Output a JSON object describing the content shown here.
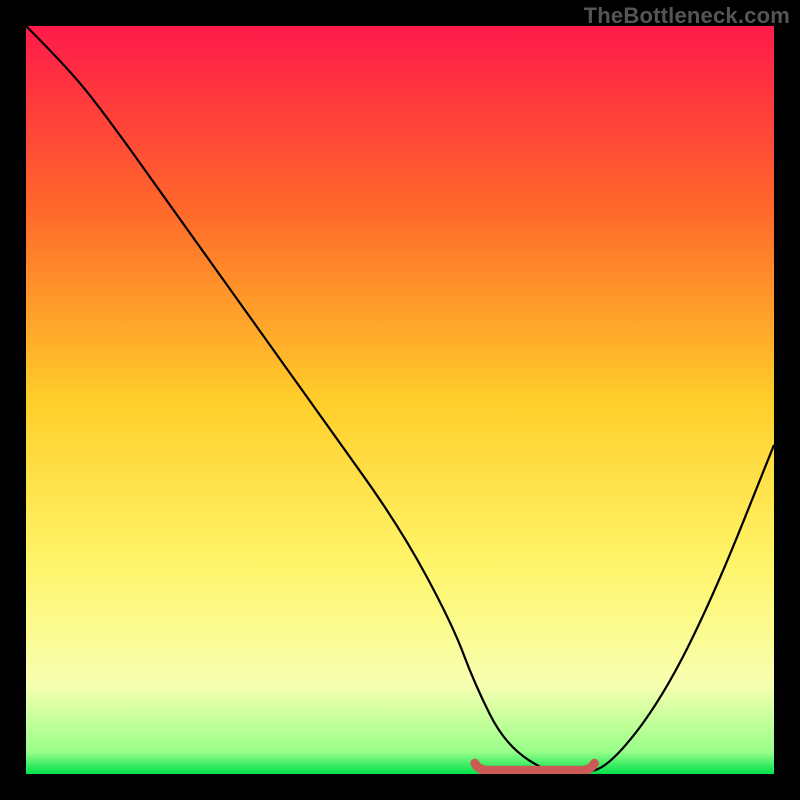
{
  "watermark": "TheBottleneck.com",
  "chart_data": {
    "type": "line",
    "title": "",
    "xlabel": "",
    "ylabel": "",
    "xlim": [
      0,
      100
    ],
    "ylim": [
      0,
      100
    ],
    "grid": false,
    "legend": false,
    "gradient_stops": [
      {
        "offset": 0,
        "color": "#ff1a4a"
      },
      {
        "offset": 25,
        "color": "#ff6a2a"
      },
      {
        "offset": 50,
        "color": "#ffce2a"
      },
      {
        "offset": 72,
        "color": "#fff56a"
      },
      {
        "offset": 88,
        "color": "#f7ffb0"
      },
      {
        "offset": 97,
        "color": "#9aff8a"
      },
      {
        "offset": 100,
        "color": "#00e04a"
      }
    ],
    "series": [
      {
        "name": "bottleneck-curve",
        "color": "#000000",
        "x": [
          0,
          5,
          10,
          20,
          30,
          40,
          50,
          57,
          60,
          64,
          70,
          74,
          78,
          85,
          92,
          100
        ],
        "y": [
          100,
          95,
          89,
          75,
          61,
          47,
          33,
          20,
          12,
          4,
          0,
          0,
          1,
          10,
          24,
          44
        ]
      }
    ],
    "flat_region": {
      "color": "#cc5a55",
      "x_start": 60,
      "x_end": 76,
      "y": 0.5
    }
  }
}
